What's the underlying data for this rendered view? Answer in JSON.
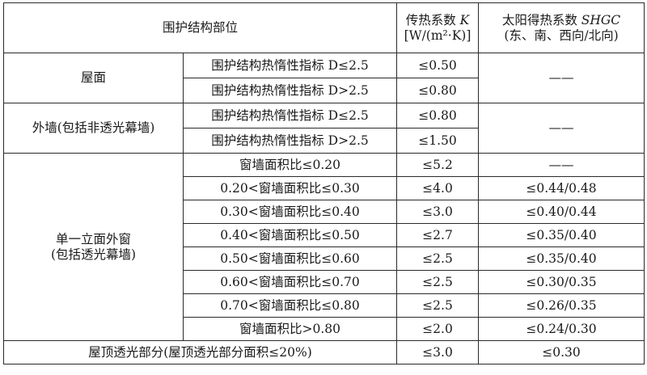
{
  "header": {
    "part": "围护结构部位",
    "k_title": "传热系数",
    "k_symbol": "K",
    "k_unit": "[W/(m²·K)]",
    "shgc_title": "太阳得热系数",
    "shgc_symbol": "SHGC",
    "shgc_sub": "(东、南、西向/北向)"
  },
  "roof": {
    "label": "屋面",
    "rows": [
      {
        "cond": "围护结构热惰性指标 D≤2.5",
        "k": "≤0.50",
        "shgc": "——"
      },
      {
        "cond": "围护结构热惰性指标 D>2.5",
        "k": "≤0.80"
      }
    ]
  },
  "wall": {
    "label": "外墙(包括非透光幕墙)",
    "rows": [
      {
        "cond": "围护结构热惰性指标 D≤2.5",
        "k": "≤0.80",
        "shgc": "——"
      },
      {
        "cond": "围护结构热惰性指标 D>2.5",
        "k": "≤1.50"
      }
    ]
  },
  "window": {
    "label_line1": "单一立面外窗",
    "label_line2": "(包括透光幕墙)",
    "rows": [
      {
        "cond": "窗墙面积比≤0.20",
        "k": "≤5.2",
        "shgc": "——"
      },
      {
        "cond": "0.20<窗墙面积比≤0.30",
        "k": "≤4.0",
        "shgc": "≤0.44/0.48"
      },
      {
        "cond": "0.30<窗墙面积比≤0.40",
        "k": "≤3.0",
        "shgc": "≤0.40/0.44"
      },
      {
        "cond": "0.40<窗墙面积比≤0.50",
        "k": "≤2.7",
        "shgc": "≤0.35/0.40"
      },
      {
        "cond": "0.50<窗墙面积比≤0.60",
        "k": "≤2.5",
        "shgc": "≤0.35/0.40"
      },
      {
        "cond": "0.60<窗墙面积比≤0.70",
        "k": "≤2.5",
        "shgc": "≤0.30/0.35"
      },
      {
        "cond": "0.70<窗墙面积比≤0.80",
        "k": "≤2.5",
        "shgc": "≤0.26/0.35"
      },
      {
        "cond": "窗墙面积比>0.80",
        "k": "≤2.0",
        "shgc": "≤0.24/0.30"
      }
    ]
  },
  "skylight": {
    "label": "屋顶透光部分(屋顶透光部分面积≤20%)",
    "k": "≤3.0",
    "shgc": "≤0.30"
  }
}
